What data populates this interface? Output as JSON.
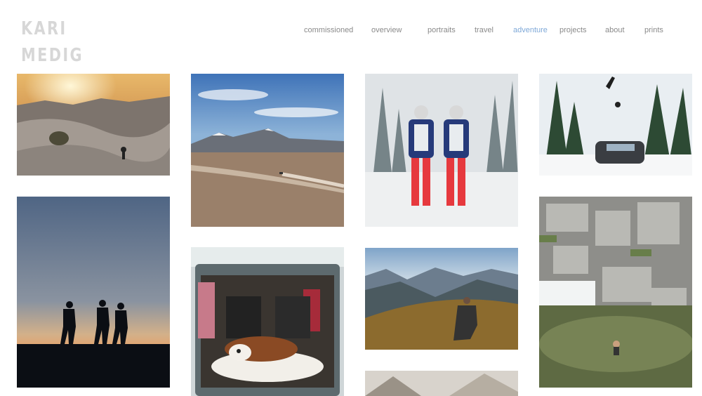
{
  "logo": {
    "line1": "KARI",
    "line2": "MEDIG"
  },
  "nav": {
    "items": [
      {
        "label": "commissioned"
      },
      {
        "label": "overview"
      },
      {
        "label": "portraits"
      },
      {
        "label": "travel"
      },
      {
        "label": "adventure",
        "active": true
      },
      {
        "label": "projects"
      },
      {
        "label": "about"
      },
      {
        "label": "prints"
      }
    ],
    "active_color": "#7fa9d8",
    "text_color": "#8a8a8a"
  },
  "gallery": {
    "photos": [
      {
        "subject": "desert-sunset-cyclists"
      },
      {
        "subject": "salt-flat-volcano-dust"
      },
      {
        "subject": "red-bull-skiers"
      },
      {
        "subject": "snowboarder-jump-mini"
      },
      {
        "subject": "hikers-silhouette-dusk"
      },
      {
        "subject": "dog-in-jeep-trunk"
      },
      {
        "subject": "mountain-meadow-sitter"
      },
      {
        "subject": "rocky-alpine-pond-swimmer"
      },
      {
        "subject": "partial-tent-photo"
      }
    ]
  }
}
